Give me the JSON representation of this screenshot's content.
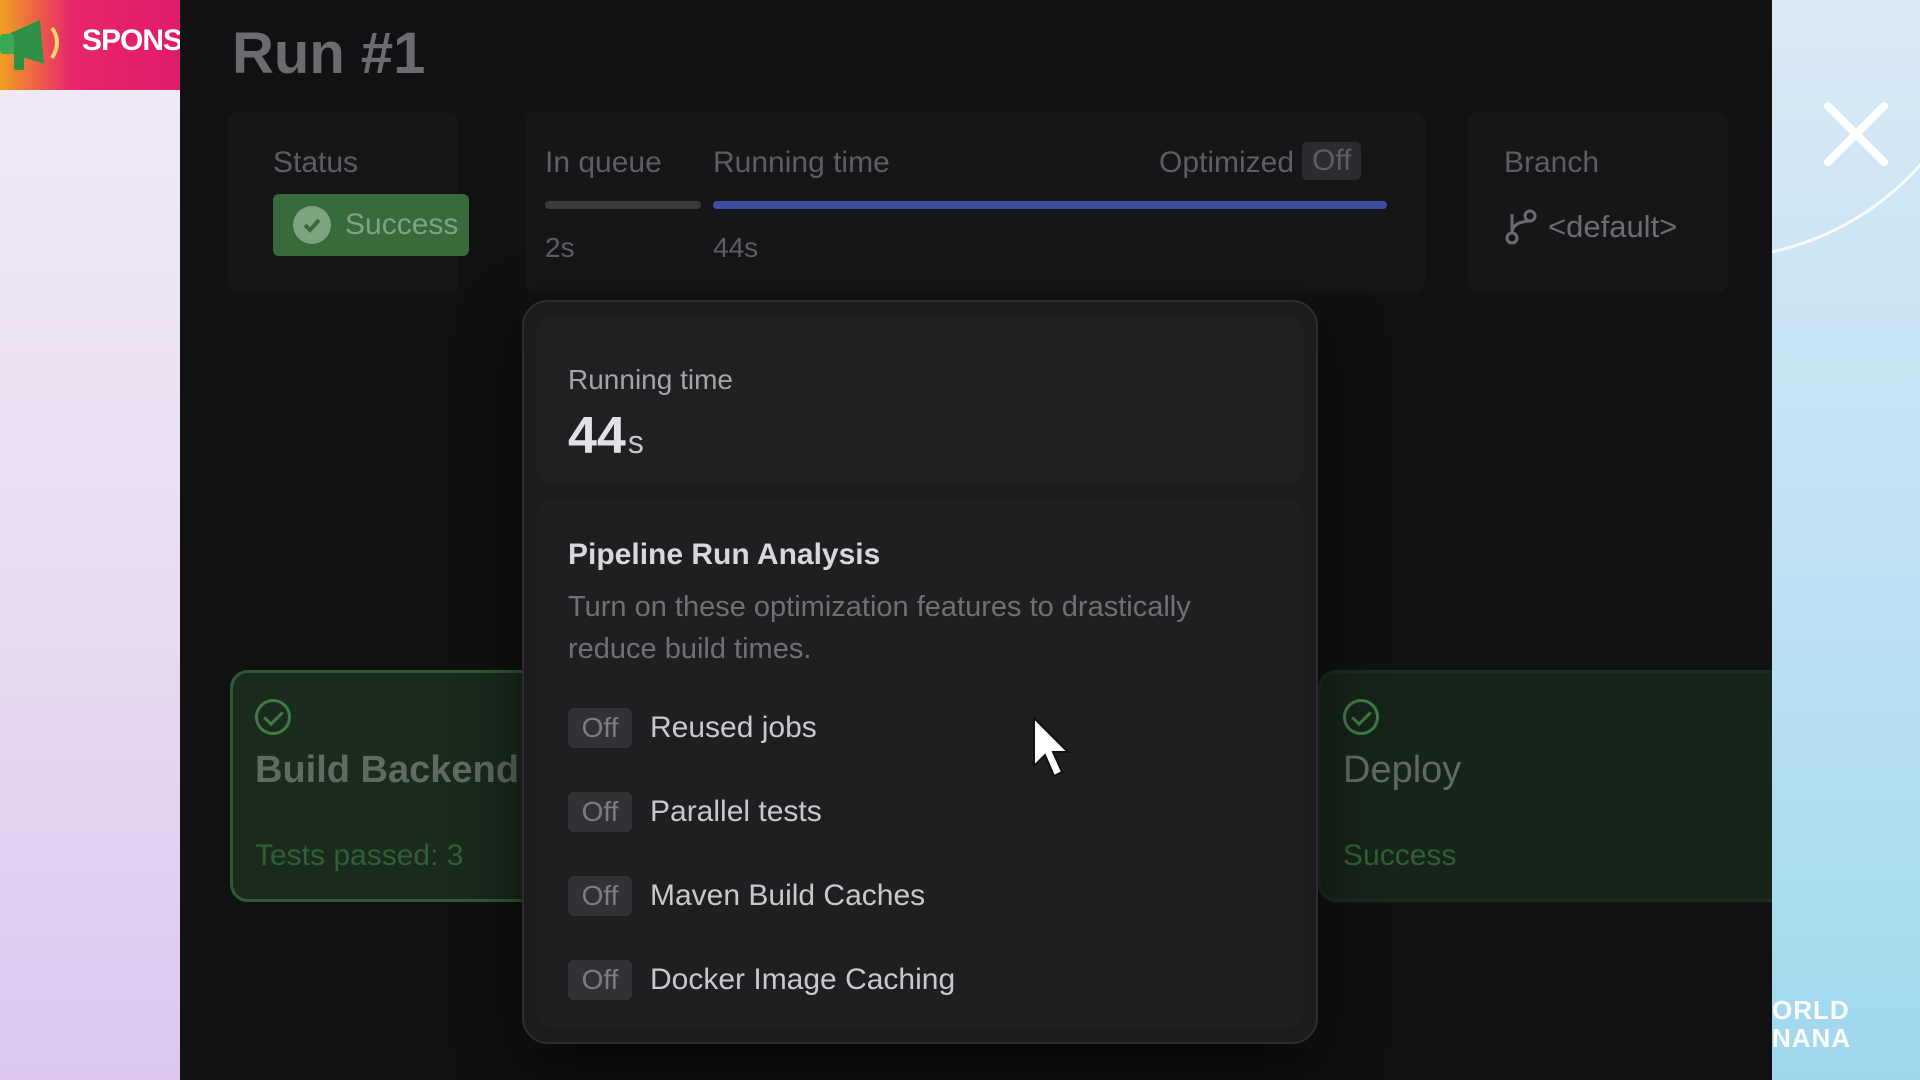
{
  "sponsor": {
    "text": "SPONSO"
  },
  "watermark": {
    "line1": "ORLD",
    "line2": "NANA"
  },
  "run": {
    "title": "Run #1"
  },
  "status_card": {
    "label": "Status",
    "value": "Success"
  },
  "timing_card": {
    "in_queue_label": "In queue",
    "in_queue_value": "2s",
    "running_label": "Running time",
    "running_value": "44s",
    "optimized_label": "Optimized",
    "optimized_value": "Off",
    "running_progress": 1.0
  },
  "branch_card": {
    "label": "Branch",
    "value": "<default>"
  },
  "jobs": [
    {
      "name": "Build Backend",
      "sub": "Tests passed: 3"
    },
    {
      "name": "Deploy",
      "sub": "Success"
    }
  ],
  "popover": {
    "running_label": "Running time",
    "running_value": "44",
    "running_unit": "s",
    "title": "Pipeline Run Analysis",
    "description": "Turn on these optimization features to drastically reduce build times.",
    "features": [
      {
        "toggle": "Off",
        "name": "Reused jobs"
      },
      {
        "toggle": "Off",
        "name": "Parallel tests"
      },
      {
        "toggle": "Off",
        "name": "Maven Build Caches"
      },
      {
        "toggle": "Off",
        "name": "Docker Image Caching"
      }
    ]
  },
  "colors": {
    "accent_bar": "#3b4f9e",
    "success_green": "#386b3c",
    "sponsor_pink": "#e01b6e"
  }
}
